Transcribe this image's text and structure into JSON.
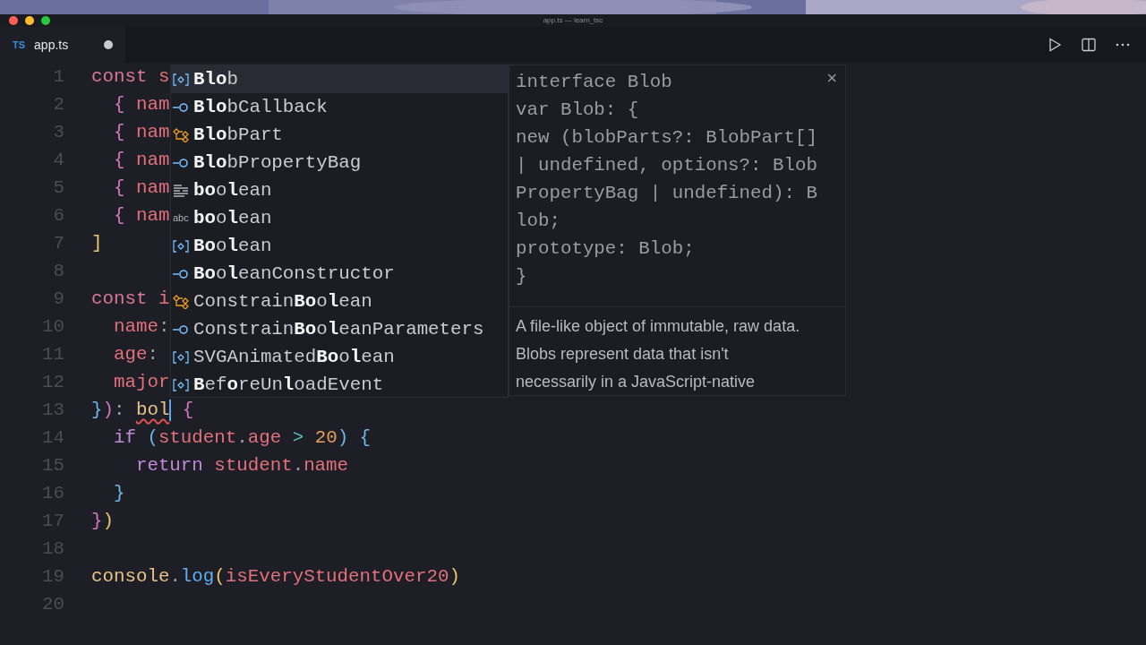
{
  "window": {
    "title": "app.ts — learn_tsc"
  },
  "tabs": [
    {
      "icon_label": "TS",
      "label": "app.ts",
      "modified": true,
      "selected": true
    }
  ],
  "editor": {
    "lines": [
      {
        "number": "1",
        "tokens": [
          {
            "text": "const",
            "kind": "storage"
          },
          {
            "text": " s",
            "kind": "variable"
          }
        ]
      },
      {
        "number": "2",
        "tokens": [
          {
            "text": "  {",
            "kind": "brace_pink"
          },
          {
            "text": " nam",
            "kind": "variable"
          }
        ]
      },
      {
        "number": "3",
        "tokens": [
          {
            "text": "  {",
            "kind": "brace_pink"
          },
          {
            "text": " nam",
            "kind": "variable"
          }
        ]
      },
      {
        "number": "4",
        "tokens": [
          {
            "text": "  {",
            "kind": "brace_pink"
          },
          {
            "text": " nam",
            "kind": "variable"
          }
        ]
      },
      {
        "number": "5",
        "tokens": [
          {
            "text": "  {",
            "kind": "brace_pink"
          },
          {
            "text": " nam",
            "kind": "variable"
          }
        ]
      },
      {
        "number": "6",
        "tokens": [
          {
            "text": "  {",
            "kind": "brace_pink"
          },
          {
            "text": " nam",
            "kind": "variable"
          }
        ]
      },
      {
        "number": "7",
        "tokens": [
          {
            "text": "]",
            "kind": "brace_yellow"
          }
        ]
      },
      {
        "number": "8"
      },
      {
        "number": "9",
        "tokens": [
          {
            "text": "const",
            "kind": "storage"
          },
          {
            "text": " i",
            "kind": "variable"
          }
        ]
      },
      {
        "number": "10",
        "tokens": [
          {
            "text": "  name",
            "kind": "variable"
          },
          {
            "text": ":",
            "kind": "plain"
          }
        ]
      },
      {
        "number": "11",
        "tokens": [
          {
            "text": "  age",
            "kind": "variable"
          },
          {
            "text": ":",
            "kind": "plain"
          }
        ]
      },
      {
        "number": "12",
        "tokens": [
          {
            "text": "  major",
            "kind": "variable"
          }
        ]
      },
      {
        "number": "13",
        "tokens": [
          {
            "text": "}",
            "kind": "brace_blue"
          },
          {
            "text": ")",
            "kind": "brace_pink"
          },
          {
            "text": ": ",
            "kind": "plain"
          },
          {
            "text": "bol",
            "kind": "type",
            "error": true,
            "cursor": true
          },
          {
            "text": " {",
            "kind": "brace_pink"
          }
        ]
      },
      {
        "number": "14",
        "tokens": [
          {
            "text": "  if",
            "kind": "keyword"
          },
          {
            "text": " (",
            "kind": "brace_blue"
          },
          {
            "text": "student",
            "kind": "variable"
          },
          {
            "text": ".",
            "kind": "plain"
          },
          {
            "text": "age",
            "kind": "variable"
          },
          {
            "text": " > ",
            "kind": "operator"
          },
          {
            "text": "20",
            "kind": "number"
          },
          {
            "text": ")",
            "kind": "brace_blue"
          },
          {
            "text": " {",
            "kind": "brace_blue"
          }
        ]
      },
      {
        "number": "15",
        "tokens": [
          {
            "text": "    return",
            "kind": "keyword"
          },
          {
            "text": " student",
            "kind": "variable"
          },
          {
            "text": ".",
            "kind": "plain"
          },
          {
            "text": "name",
            "kind": "variable"
          }
        ]
      },
      {
        "number": "16",
        "tokens": [
          {
            "text": "  }",
            "kind": "brace_blue"
          }
        ]
      },
      {
        "number": "17",
        "tokens": [
          {
            "text": "}",
            "kind": "brace_pink"
          },
          {
            "text": ")",
            "kind": "brace_yellow"
          }
        ]
      },
      {
        "number": "18"
      },
      {
        "number": "19",
        "tokens": [
          {
            "text": "console",
            "kind": "type"
          },
          {
            "text": ".",
            "kind": "plain"
          },
          {
            "text": "log",
            "kind": "function"
          },
          {
            "text": "(",
            "kind": "brace_yellow"
          },
          {
            "text": "isEveryStudentOver20",
            "kind": "variable"
          },
          {
            "text": ")",
            "kind": "brace_yellow"
          }
        ]
      },
      {
        "number": "20"
      }
    ]
  },
  "suggestions": [
    {
      "kind": "variable",
      "label": "**Blo**b",
      "selected": true
    },
    {
      "kind": "interface",
      "label": "**Blo**bCallback",
      "selected": false
    },
    {
      "kind": "type_parameter",
      "label": "**Blo**bPart",
      "selected": false
    },
    {
      "kind": "interface",
      "label": "**Blo**bPropertyBag",
      "selected": false
    },
    {
      "kind": "keyword",
      "label": "**bo**o**l**ean",
      "selected": false
    },
    {
      "kind": "text",
      "icon_label": "abc",
      "label": "**bo**o**l**ean",
      "selected": false
    },
    {
      "kind": "variable",
      "label": "**Bo**o**l**ean",
      "selected": false
    },
    {
      "kind": "interface",
      "label": "**Bo**o**l**eanConstructor",
      "selected": false
    },
    {
      "kind": "type_parameter",
      "label": "Constrain**Bo**o**l**ean",
      "selected": false
    },
    {
      "kind": "interface",
      "label": "Constrain**Bo**o**l**eanParameters",
      "selected": false
    },
    {
      "kind": "variable",
      "label": "SVGAnimated**Bo**o**l**ean",
      "selected": false
    },
    {
      "kind": "variable",
      "label": "**B**ef**o**reUn**l**oadEvent",
      "selected": false
    }
  ],
  "hover": {
    "close": "×",
    "code_lines": [
      "interface Blob",
      "var Blob: {",
      "new (blobParts?: BlobPart[]",
      "| undefined, options?: Blob",
      "PropertyBag | undefined): B",
      "lob;",
      "prototype: Blob;",
      "}"
    ],
    "description_lines": [
      "A file-like object of immutable, raw data.",
      "Blobs represent data that isn't",
      "necessarily in a JavaScript-native"
    ]
  }
}
